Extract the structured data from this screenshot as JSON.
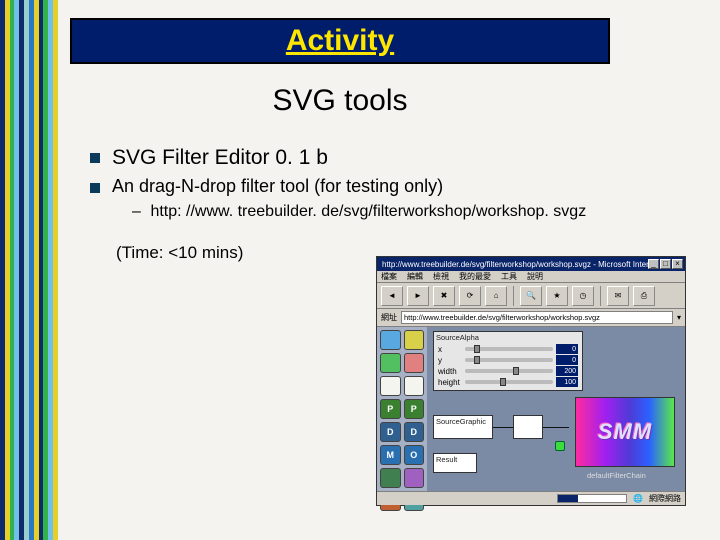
{
  "sidebar_stripes": [
    "#0d2a6a",
    "#e7cf2a",
    "#33b14a",
    "#71c0ea",
    "#0d2a6a",
    "#9cc",
    "#2a78c4",
    "#e7cf2a",
    "#0d2a6a",
    "#33b14a",
    "#71c0ea",
    "#e7cf2a"
  ],
  "banner": {
    "title": "Activity"
  },
  "subtitle": "SVG tools",
  "bullets": {
    "item1": "SVG Filter Editor 0. 1 b",
    "item2": "An drag-N-drop filter tool (for testing only)",
    "item2_sub": "http: //www. treebuilder. de/svg/filterworkshop/workshop. svgz"
  },
  "time_note": "(Time: <10 mins)",
  "app": {
    "title": "http://www.treebuilder.de/svg/filterworkshop/workshop.svgz - Microsoft Internet Explorer",
    "menus": [
      "檔案",
      "編輯",
      "檢視",
      "我的最愛",
      "工具",
      "說明"
    ],
    "address_label": "網址",
    "address_value": "http://www.treebuilder.de/svg/filterworkshop/workshop.svgz",
    "palette_colors": [
      "#5aa8e0",
      "#d8d048",
      "#52c060",
      "#e08080",
      "#f5f5f0",
      "#f5f5f0",
      "#3a8030",
      "#3a8030",
      "#306090",
      "#306090",
      "#2a70b0",
      "#2a70b0",
      "#408050",
      "#a060c0",
      "#c06030",
      "#50a0a0"
    ],
    "palette_labels": [
      "",
      "",
      "",
      "",
      "",
      "",
      "P",
      "P",
      "D",
      "D",
      "M",
      "O",
      "",
      "",
      "",
      ""
    ],
    "controls_panel": {
      "title": "SourceAlpha",
      "rows": [
        {
          "label": "x",
          "val": "0"
        },
        {
          "label": "y",
          "val": "0"
        },
        {
          "label": "width",
          "val": "200"
        },
        {
          "label": "height",
          "val": "100"
        }
      ]
    },
    "nodes": {
      "source": "SourceGraphic",
      "middle": "",
      "result": "Result"
    },
    "smm": "SMM",
    "caption_under": "defaultFilterChain",
    "status_left": "",
    "status_right": "網際網路"
  }
}
